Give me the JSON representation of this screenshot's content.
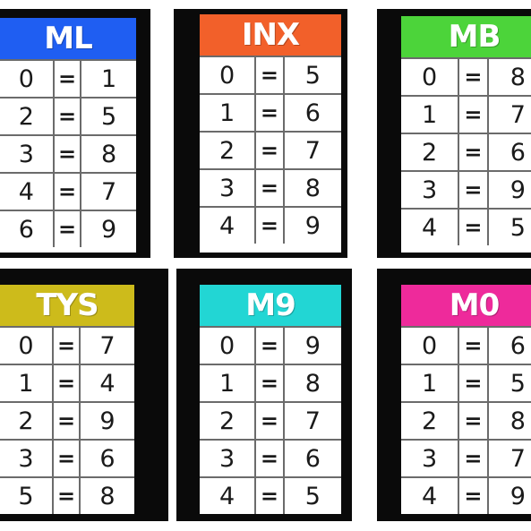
{
  "colors": {
    "ML": "#1f5ef2",
    "INX": "#f2602a",
    "MB": "#4cd43a",
    "TYS": "#cdbb1b",
    "M9": "#22d6d4",
    "M0": "#ee2a9b"
  },
  "cards": [
    {
      "title": "ML",
      "rows": [
        {
          "left": "0",
          "sep": "=",
          "right": "1"
        },
        {
          "left": "2",
          "sep": "=",
          "right": "5"
        },
        {
          "left": "3",
          "sep": "=",
          "right": "8"
        },
        {
          "left": "4",
          "sep": "=",
          "right": "7"
        },
        {
          "left": "6",
          "sep": "=",
          "right": "9"
        }
      ]
    },
    {
      "title": "INX",
      "rows": [
        {
          "left": "0",
          "sep": "=",
          "right": "5"
        },
        {
          "left": "1",
          "sep": "=",
          "right": "6"
        },
        {
          "left": "2",
          "sep": "=",
          "right": "7"
        },
        {
          "left": "3",
          "sep": "=",
          "right": "8"
        },
        {
          "left": "4",
          "sep": "=",
          "right": "9"
        }
      ]
    },
    {
      "title": "MB",
      "rows": [
        {
          "left": "0",
          "sep": "=",
          "right": "8"
        },
        {
          "left": "1",
          "sep": "=",
          "right": "7"
        },
        {
          "left": "2",
          "sep": "=",
          "right": "6"
        },
        {
          "left": "3",
          "sep": "=",
          "right": "9"
        },
        {
          "left": "4",
          "sep": "=",
          "right": "5"
        }
      ]
    },
    {
      "title": "TYS",
      "rows": [
        {
          "left": "0",
          "sep": "=",
          "right": "7"
        },
        {
          "left": "1",
          "sep": "=",
          "right": "4"
        },
        {
          "left": "2",
          "sep": "=",
          "right": "9"
        },
        {
          "left": "3",
          "sep": "=",
          "right": "6"
        },
        {
          "left": "5",
          "sep": "=",
          "right": "8"
        }
      ]
    },
    {
      "title": "M9",
      "rows": [
        {
          "left": "0",
          "sep": "=",
          "right": "9"
        },
        {
          "left": "1",
          "sep": "=",
          "right": "8"
        },
        {
          "left": "2",
          "sep": "=",
          "right": "7"
        },
        {
          "left": "3",
          "sep": "=",
          "right": "6"
        },
        {
          "left": "4",
          "sep": "=",
          "right": "5"
        }
      ]
    },
    {
      "title": "M0",
      "rows": [
        {
          "left": "0",
          "sep": "=",
          "right": "6"
        },
        {
          "left": "1",
          "sep": "=",
          "right": "5"
        },
        {
          "left": "2",
          "sep": "=",
          "right": "8"
        },
        {
          "left": "3",
          "sep": "=",
          "right": "7"
        },
        {
          "left": "4",
          "sep": "=",
          "right": "9"
        }
      ]
    }
  ]
}
